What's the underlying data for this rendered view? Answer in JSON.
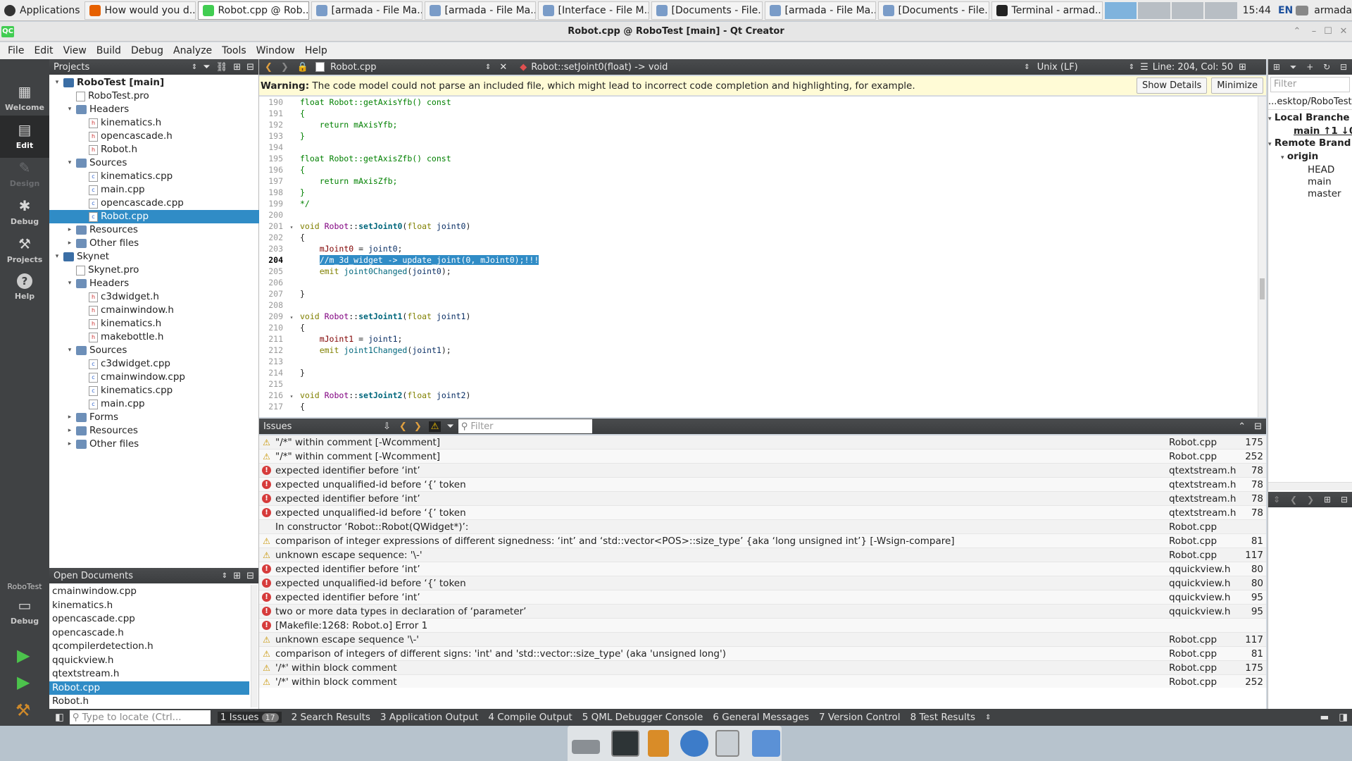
{
  "taskbar": {
    "apps_label": "Applications",
    "tasks": [
      "How would you d...",
      "Robot.cpp @ Rob...",
      "[armada - File Ma...",
      "[armada - File Ma...",
      "[Interface - File M...",
      "[Documents - File...",
      "[armada - File Ma...",
      "[Documents - File...",
      "Terminal - armad..."
    ],
    "clock": "15:44",
    "lang": "EN",
    "user": "armada"
  },
  "window": {
    "title": "Robot.cpp @ RoboTest [main] - Qt Creator"
  },
  "menu": [
    "File",
    "Edit",
    "View",
    "Build",
    "Debug",
    "Analyze",
    "Tools",
    "Window",
    "Help"
  ],
  "modes": {
    "welcome": "Welcome",
    "edit": "Edit",
    "design": "Design",
    "debug": "Debug",
    "projects": "Projects",
    "help": "Help",
    "kit": "RoboTest",
    "kit_mode": "Debug"
  },
  "projects": {
    "header": "Projects",
    "tree": [
      {
        "label": "RoboTest [main]",
        "depth": 0,
        "kind": "project",
        "exp": "v",
        "bold": true
      },
      {
        "label": "RoboTest.pro",
        "depth": 1,
        "kind": "file"
      },
      {
        "label": "Headers",
        "depth": 1,
        "kind": "folder",
        "exp": "v"
      },
      {
        "label": "kinematics.h",
        "depth": 2,
        "kind": "h"
      },
      {
        "label": "opencascade.h",
        "depth": 2,
        "kind": "h"
      },
      {
        "label": "Robot.h",
        "depth": 2,
        "kind": "h"
      },
      {
        "label": "Sources",
        "depth": 1,
        "kind": "folder",
        "exp": "v"
      },
      {
        "label": "kinematics.cpp",
        "depth": 2,
        "kind": "cpp"
      },
      {
        "label": "main.cpp",
        "depth": 2,
        "kind": "cpp"
      },
      {
        "label": "opencascade.cpp",
        "depth": 2,
        "kind": "cpp"
      },
      {
        "label": "Robot.cpp",
        "depth": 2,
        "kind": "cpp",
        "selected": true
      },
      {
        "label": "Resources",
        "depth": 1,
        "kind": "folder",
        "exp": ">"
      },
      {
        "label": "Other files",
        "depth": 1,
        "kind": "folder",
        "exp": ">"
      },
      {
        "label": "Skynet",
        "depth": 0,
        "kind": "project",
        "exp": "v"
      },
      {
        "label": "Skynet.pro",
        "depth": 1,
        "kind": "file"
      },
      {
        "label": "Headers",
        "depth": 1,
        "kind": "folder",
        "exp": "v"
      },
      {
        "label": "c3dwidget.h",
        "depth": 2,
        "kind": "h"
      },
      {
        "label": "cmainwindow.h",
        "depth": 2,
        "kind": "h"
      },
      {
        "label": "kinematics.h",
        "depth": 2,
        "kind": "h"
      },
      {
        "label": "makebottle.h",
        "depth": 2,
        "kind": "h"
      },
      {
        "label": "Sources",
        "depth": 1,
        "kind": "folder",
        "exp": "v"
      },
      {
        "label": "c3dwidget.cpp",
        "depth": 2,
        "kind": "cpp"
      },
      {
        "label": "cmainwindow.cpp",
        "depth": 2,
        "kind": "cpp"
      },
      {
        "label": "kinematics.cpp",
        "depth": 2,
        "kind": "cpp"
      },
      {
        "label": "main.cpp",
        "depth": 2,
        "kind": "cpp"
      },
      {
        "label": "Forms",
        "depth": 1,
        "kind": "folder",
        "exp": ">"
      },
      {
        "label": "Resources",
        "depth": 1,
        "kind": "folder",
        "exp": ">"
      },
      {
        "label": "Other files",
        "depth": 1,
        "kind": "folder",
        "exp": ">"
      }
    ]
  },
  "open_documents": {
    "header": "Open Documents",
    "items": [
      "cmainwindow.cpp",
      "kinematics.h",
      "opencascade.cpp",
      "opencascade.h",
      "qcompilerdetection.h",
      "qquickview.h",
      "qtextstream.h",
      "Robot.cpp",
      "Robot.h"
    ],
    "selected": "Robot.cpp"
  },
  "editor": {
    "file": "Robot.cpp",
    "symbol": "Robot::setJoint0(float) -> void",
    "line_ending": "Unix (LF)",
    "position": "Line: 204, Col: 50",
    "current_line": 204,
    "warning_bold": "Warning:",
    "warning_text": " The code model could not parse an included file, which might lead to incorrect code completion and highlighting, for example.",
    "show_details": "Show Details",
    "minimize": "Minimize",
    "lines": [
      {
        "n": 190,
        "segs": [
          [
            "cm",
            "float Robot::getAxisYfb() const"
          ]
        ]
      },
      {
        "n": 191,
        "segs": [
          [
            "cm",
            "{"
          ]
        ]
      },
      {
        "n": 192,
        "segs": [
          [
            "cm",
            "    return mAxisYfb;"
          ]
        ]
      },
      {
        "n": 193,
        "segs": [
          [
            "cm",
            "}"
          ]
        ]
      },
      {
        "n": 194,
        "segs": []
      },
      {
        "n": 195,
        "segs": [
          [
            "cm",
            "float Robot::getAxisZfb() const"
          ]
        ]
      },
      {
        "n": 196,
        "segs": [
          [
            "cm",
            "{"
          ]
        ]
      },
      {
        "n": 197,
        "segs": [
          [
            "cm",
            "    return mAxisZfb;"
          ]
        ]
      },
      {
        "n": 198,
        "segs": [
          [
            "cm",
            "}"
          ]
        ]
      },
      {
        "n": 199,
        "segs": [
          [
            "cm",
            "*/"
          ]
        ]
      },
      {
        "n": 200,
        "segs": []
      },
      {
        "n": 201,
        "fold": true,
        "segs": [
          [
            "kw",
            "void "
          ],
          [
            "cls",
            "Robot"
          ],
          [
            "",
            "::"
          ],
          [
            "fnb",
            "setJoint0"
          ],
          [
            "",
            "("
          ],
          [
            "kw",
            "float "
          ],
          [
            "prm",
            "joint0"
          ],
          [
            "",
            ")"
          ]
        ]
      },
      {
        "n": 202,
        "segs": [
          [
            "",
            "{"
          ]
        ]
      },
      {
        "n": 203,
        "segs": [
          [
            "",
            "    "
          ],
          [
            "mem",
            "mJoint0"
          ],
          [
            "",
            " = "
          ],
          [
            "prm",
            "joint0"
          ],
          [
            "",
            ";"
          ]
        ]
      },
      {
        "n": 204,
        "segs": [
          [
            "",
            "    "
          ],
          [
            "hl",
            "//m_3d_widget -> update_joint(0, mJoint0);!!!"
          ]
        ]
      },
      {
        "n": 205,
        "segs": [
          [
            "",
            "    "
          ],
          [
            "kw",
            "emit "
          ],
          [
            "fn",
            "joint0Changed"
          ],
          [
            "",
            "("
          ],
          [
            "prm",
            "joint0"
          ],
          [
            "",
            ");"
          ]
        ]
      },
      {
        "n": 206,
        "segs": []
      },
      {
        "n": 207,
        "segs": [
          [
            "",
            "}"
          ]
        ]
      },
      {
        "n": 208,
        "segs": []
      },
      {
        "n": 209,
        "fold": true,
        "segs": [
          [
            "kw",
            "void "
          ],
          [
            "cls",
            "Robot"
          ],
          [
            "",
            "::"
          ],
          [
            "fnb",
            "setJoint1"
          ],
          [
            "",
            "("
          ],
          [
            "kw",
            "float "
          ],
          [
            "prm",
            "joint1"
          ],
          [
            "",
            ")"
          ]
        ]
      },
      {
        "n": 210,
        "segs": [
          [
            "",
            "{"
          ]
        ]
      },
      {
        "n": 211,
        "segs": [
          [
            "",
            "    "
          ],
          [
            "mem",
            "mJoint1"
          ],
          [
            "",
            " = "
          ],
          [
            "prm",
            "joint1"
          ],
          [
            "",
            ";"
          ]
        ]
      },
      {
        "n": 212,
        "segs": [
          [
            "",
            "    "
          ],
          [
            "kw",
            "emit "
          ],
          [
            "fn",
            "joint1Changed"
          ],
          [
            "",
            "("
          ],
          [
            "prm",
            "joint1"
          ],
          [
            "",
            ");"
          ]
        ]
      },
      {
        "n": 213,
        "segs": []
      },
      {
        "n": 214,
        "segs": [
          [
            "",
            "}"
          ]
        ]
      },
      {
        "n": 215,
        "segs": []
      },
      {
        "n": 216,
        "fold": true,
        "segs": [
          [
            "kw",
            "void "
          ],
          [
            "cls",
            "Robot"
          ],
          [
            "",
            "::"
          ],
          [
            "fnb",
            "setJoint2"
          ],
          [
            "",
            "("
          ],
          [
            "kw",
            "float "
          ],
          [
            "prm",
            "joint2"
          ],
          [
            "",
            ")"
          ]
        ]
      },
      {
        "n": 217,
        "segs": [
          [
            "",
            "{"
          ]
        ]
      }
    ]
  },
  "issues": {
    "header": "Issues",
    "filter_placeholder": "Filter",
    "rows": [
      {
        "sev": "w",
        "text": "\"/*\" within comment [-Wcomment]",
        "file": "Robot.cpp",
        "line": "175"
      },
      {
        "sev": "w",
        "text": "\"/*\" within comment [-Wcomment]",
        "file": "Robot.cpp",
        "line": "252"
      },
      {
        "sev": "e",
        "text": "expected identifier before ‘int’",
        "file": "qtextstream.h",
        "line": "78"
      },
      {
        "sev": "e",
        "text": "expected unqualified-id before ‘{’ token",
        "file": "qtextstream.h",
        "line": "78"
      },
      {
        "sev": "e",
        "text": "expected identifier before ‘int’",
        "file": "qtextstream.h",
        "line": "78"
      },
      {
        "sev": "e",
        "text": "expected unqualified-id before ‘{’ token",
        "file": "qtextstream.h",
        "line": "78"
      },
      {
        "sev": "n",
        "text": "In constructor ‘Robot::Robot(QWidget*)’:",
        "file": "Robot.cpp",
        "line": ""
      },
      {
        "sev": "w",
        "text": "comparison of integer expressions of different signedness: ‘int’ and ‘std::vector<POS>::size_type’ {aka ‘long unsigned int’} [-Wsign-compare]",
        "file": "Robot.cpp",
        "line": "81"
      },
      {
        "sev": "w",
        "text": "unknown escape sequence: '\\-'",
        "file": "Robot.cpp",
        "line": "117"
      },
      {
        "sev": "e",
        "text": "expected identifier before ‘int’",
        "file": "qquickview.h",
        "line": "80"
      },
      {
        "sev": "e",
        "text": "expected unqualified-id before ‘{’ token",
        "file": "qquickview.h",
        "line": "80"
      },
      {
        "sev": "e",
        "text": "expected identifier before ‘int’",
        "file": "qquickview.h",
        "line": "95"
      },
      {
        "sev": "e",
        "text": "two or more data types in declaration of ‘parameter’",
        "file": "qquickview.h",
        "line": "95"
      },
      {
        "sev": "e",
        "text": "[Makefile:1268: Robot.o] Error 1",
        "file": "",
        "line": ""
      },
      {
        "sev": "w",
        "text": "unknown escape sequence '\\-'",
        "file": "Robot.cpp",
        "line": "117"
      },
      {
        "sev": "w",
        "text": "comparison of integers of different signs: 'int' and 'std::vector::size_type' (aka 'unsigned long')",
        "file": "Robot.cpp",
        "line": "81"
      },
      {
        "sev": "w",
        "text": "'/*' within block comment",
        "file": "Robot.cpp",
        "line": "175"
      },
      {
        "sev": "w",
        "text": "'/*' within block comment",
        "file": "Robot.cpp",
        "line": "252"
      }
    ]
  },
  "git": {
    "filter_placeholder": "Filter",
    "path": "...esktop/RoboTest",
    "local": "Local Branche",
    "current_branch": "main ↑1 ↓0",
    "remote": "Remote Brand",
    "origin": "origin",
    "refs": [
      "HEAD",
      "main",
      "master"
    ]
  },
  "statusbar": {
    "locate_placeholder": "Type to locate (Ctrl...",
    "issues_count": "17",
    "tabs": [
      "1  Issues",
      "2  Search Results",
      "3  Application Output",
      "4  Compile Output",
      "5  QML Debugger Console",
      "6  General Messages",
      "7  Version Control",
      "8  Test Results"
    ]
  },
  "colors": {
    "selection": "#308cc6",
    "sidebar": "#404244",
    "warning_bg": "#fffbd6",
    "error": "#d63b3b",
    "warn": "#c89400"
  }
}
